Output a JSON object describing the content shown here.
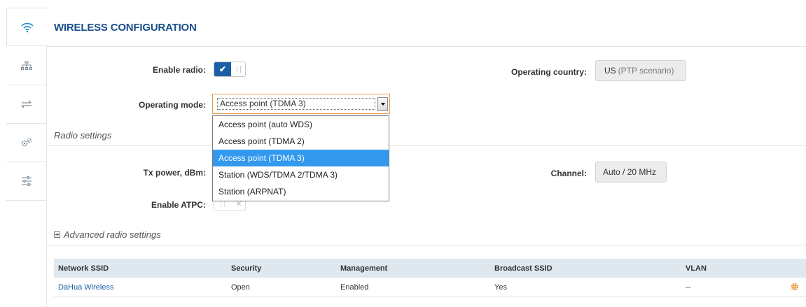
{
  "header": {
    "title": "WIRELESS CONFIGURATION"
  },
  "sidebar": {
    "items": [
      {
        "icon": "wifi-icon",
        "active": true
      },
      {
        "icon": "network-tree-icon"
      },
      {
        "icon": "transfer-arrows-icon"
      },
      {
        "icon": "gears-icon"
      },
      {
        "icon": "sliders-icon"
      }
    ]
  },
  "form": {
    "enable_radio_label": "Enable radio:",
    "enable_radio_on": true,
    "operating_country_label": "Operating country:",
    "operating_country_value": "US",
    "operating_country_note": "(PTP scenario)",
    "operating_mode_label": "Operating mode:",
    "operating_mode_value": "Access point (TDMA 3)",
    "operating_mode_options": [
      "Access point (auto WDS)",
      "Access point (TDMA 2)",
      "Access point (TDMA 3)",
      "Station (WDS/TDMA 2/TDMA 3)",
      "Station (ARPNAT)"
    ],
    "radio_settings_heading": "Radio settings",
    "tx_power_label": "Tx power, dBm:",
    "channel_label": "Channel:",
    "channel_value": "Auto / 20 MHz",
    "enable_atpc_label": "Enable ATPC:",
    "enable_atpc_on": false,
    "advanced_heading": "Advanced radio settings"
  },
  "table": {
    "headers": [
      "Network SSID",
      "Security",
      "Management",
      "Broadcast SSID",
      "VLAN"
    ],
    "rows": [
      {
        "ssid": "DaHua Wireless",
        "security": "Open",
        "management": "Enabled",
        "broadcast": "Yes",
        "vlan": "--"
      }
    ]
  },
  "colors": {
    "accent": "#1a5fa6",
    "title": "#1a4f8b",
    "selected": "#3399ee",
    "gear": "#e8953a"
  }
}
